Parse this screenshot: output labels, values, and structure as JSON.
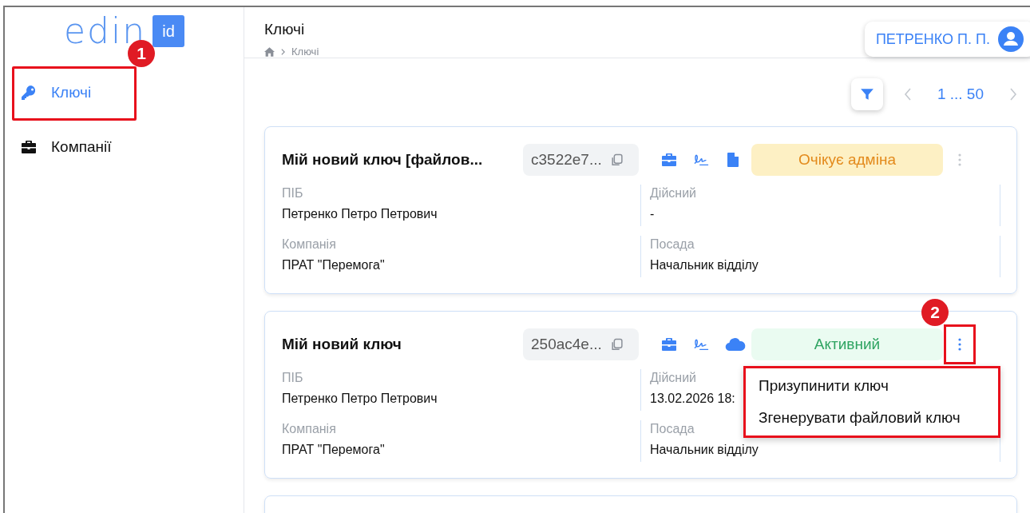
{
  "logo": {
    "text": "edin",
    "badge": "id"
  },
  "sidebar": {
    "items": [
      {
        "label": "Ключі",
        "kind": "key",
        "selected": true,
        "highlighted": true,
        "callout": "1"
      },
      {
        "label": "Компанії",
        "kind": "briefcase",
        "selected": false,
        "highlighted": false
      }
    ]
  },
  "header": {
    "title": "Ключі",
    "breadcrumb": "Ключі",
    "user": "ПЕТРЕНКО П. П."
  },
  "pagination": {
    "range": "1 ... 50"
  },
  "cards": [
    {
      "title": "Мій новий ключ [файлов...",
      "hash": "c3522e7...",
      "icons": [
        {
          "kind": "briefcase"
        },
        {
          "kind": "signature"
        },
        {
          "kind": "file"
        }
      ],
      "status": {
        "label": "Очікує адміна",
        "kind": "pending"
      },
      "menu_highlighted": false,
      "fields": [
        {
          "label": "ПІБ",
          "value": "Петренко Петро Петрович"
        },
        {
          "label": "Дійсний",
          "value": "-"
        },
        {
          "label": "Компанія",
          "value": "ПРАТ \"Перемога\""
        },
        {
          "label": "Посада",
          "value": "Начальник відділу"
        }
      ]
    },
    {
      "title": "Мій новий ключ",
      "hash": "250ac4e...",
      "icons": [
        {
          "kind": "briefcase"
        },
        {
          "kind": "signature"
        },
        {
          "kind": "cloud"
        }
      ],
      "status": {
        "label": "Активний",
        "kind": "active"
      },
      "menu_highlighted": true,
      "callout": "2",
      "fields": [
        {
          "label": "ПІБ",
          "value": "Петренко Петро Петрович"
        },
        {
          "label": "Дійсний",
          "value": "13.02.2026 18:"
        },
        {
          "label": "Компанія",
          "value": "ПРАТ \"Перемога\""
        },
        {
          "label": "Посада",
          "value": "Начальник відділу"
        }
      ],
      "menu": {
        "highlighted": true,
        "items": [
          "Призупинити ключ",
          "Згенерувати файловий ключ"
        ]
      }
    },
    {
      "kind": "partial"
    }
  ]
}
